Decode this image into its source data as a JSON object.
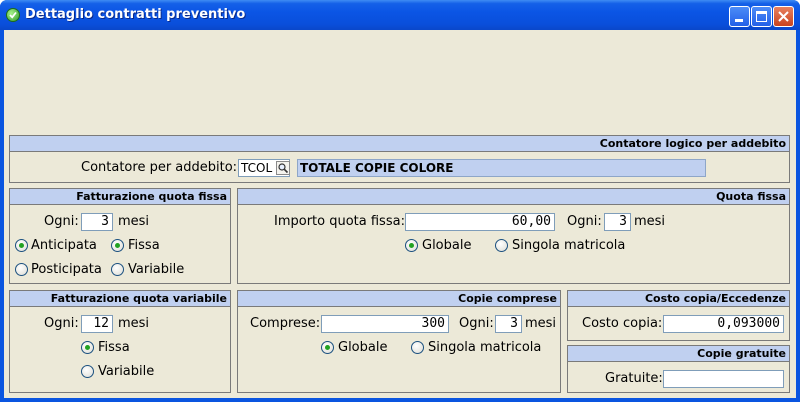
{
  "window": {
    "title": "Dettaglio contratti preventivo"
  },
  "contatore_panel": {
    "header": "Contatore logico per addebito",
    "label": "Contatore per addebito:",
    "code": "TCOL",
    "description": "TOTALE COPIE COLORE"
  },
  "fatt_fissa": {
    "header": "Fatturazione quota fissa",
    "ogni_label": "Ogni:",
    "ogni_value": "3",
    "mesi_label": "mesi",
    "opt_anticipata": "Anticipata",
    "opt_posticipata": "Posticipata",
    "opt_fissa": "Fissa",
    "opt_variabile": "Variabile",
    "timing_selected": "Anticipata",
    "mode_selected": "Fissa"
  },
  "quota_fissa": {
    "header": "Quota fissa",
    "importo_label": "Importo quota fissa:",
    "importo_value": "60,00",
    "ogni_label": "Ogni:",
    "ogni_value": "3",
    "mesi_label": "mesi",
    "opt_globale": "Globale",
    "opt_singola": "Singola matricola",
    "selected": "Globale"
  },
  "fatt_variabile": {
    "header": "Fatturazione quota variabile",
    "ogni_label": "Ogni:",
    "ogni_value": "12",
    "mesi_label": "mesi",
    "opt_fissa": "Fissa",
    "opt_variabile": "Variabile",
    "selected": "Fissa"
  },
  "copie_comprese": {
    "header": "Copie comprese",
    "comprese_label": "Comprese:",
    "comprese_value": "300",
    "ogni_label": "Ogni:",
    "ogni_value": "3",
    "mesi_label": "mesi",
    "opt_globale": "Globale",
    "opt_singola": "Singola matricola",
    "selected": "Globale"
  },
  "costo_copia": {
    "header": "Costo copia/Eccedenze",
    "label": "Costo copia:",
    "value": "0,093000"
  },
  "copie_gratuite": {
    "header": "Copie gratuite",
    "label": "Gratuite:",
    "value": ""
  },
  "colors": {
    "titlebar": "#0a55e0",
    "panel_header": "#c0d0f0",
    "client_bg": "#ece9d8",
    "radio_dot": "#21a121"
  }
}
